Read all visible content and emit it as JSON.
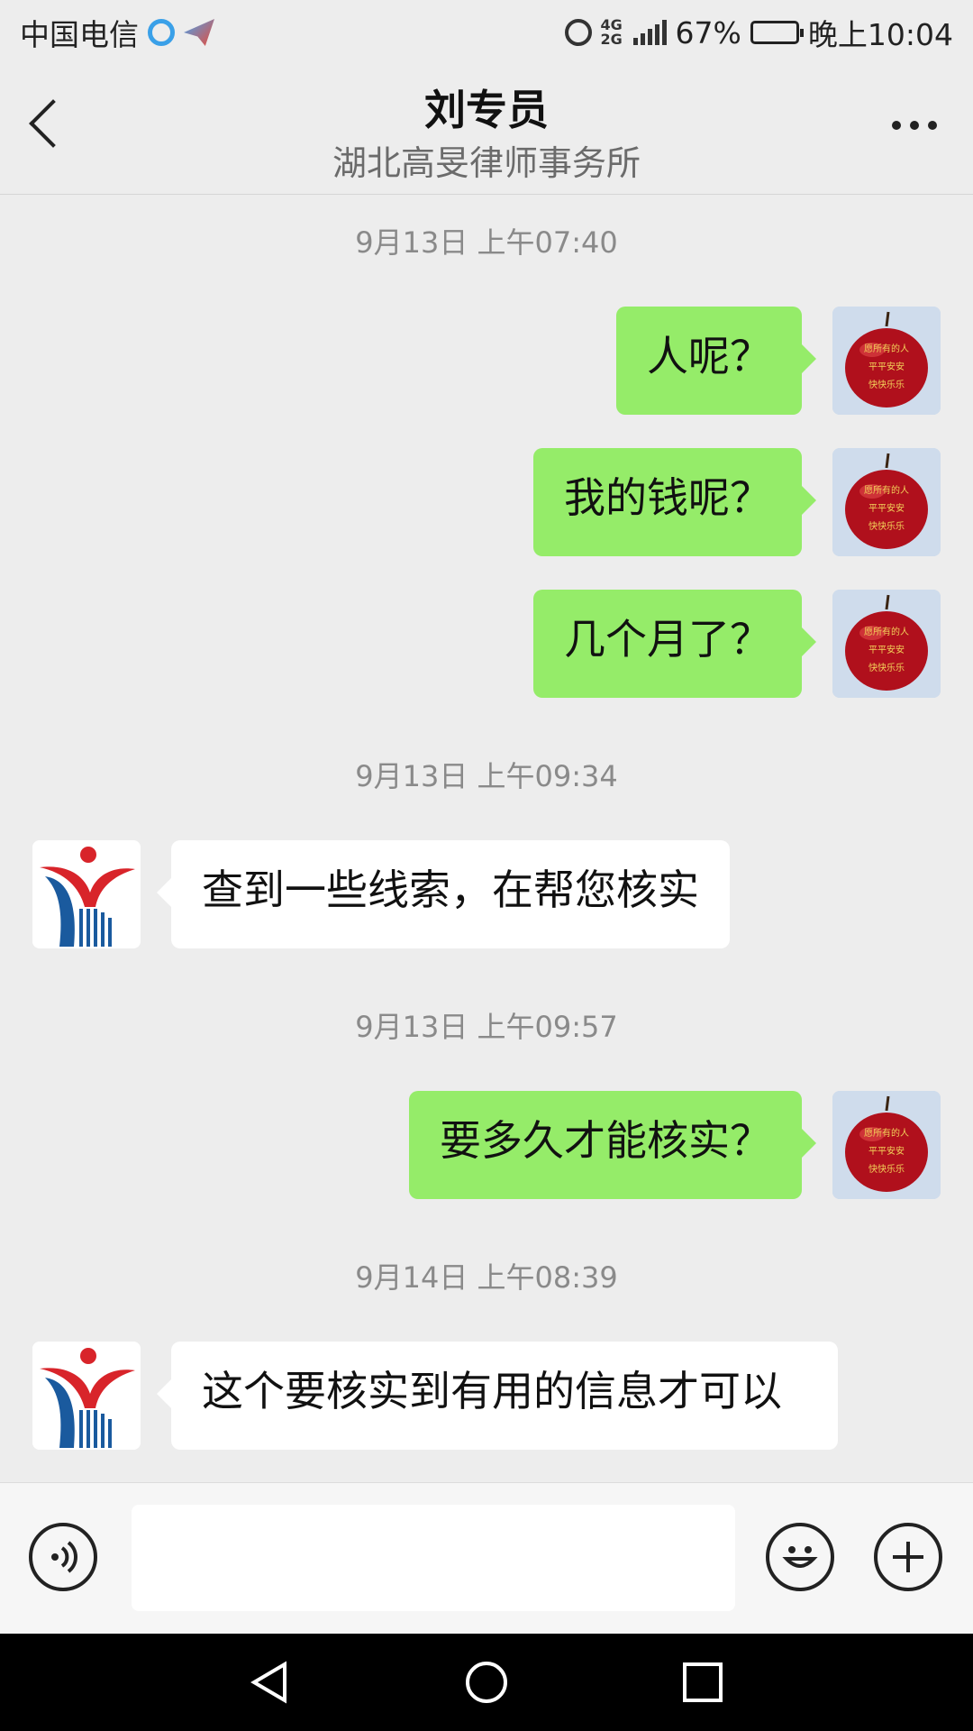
{
  "status_bar": {
    "carrier": "中国电信",
    "network": "4G 2G",
    "battery": "67%",
    "time": "晚上10:04",
    "battery_level": 0.67,
    "icons": [
      "browser-icon",
      "send-app-icon",
      "alarm-icon",
      "signal-icon",
      "battery-icon"
    ]
  },
  "header": {
    "title": "刘专员",
    "subtitle": "湖北高旻律师事务所",
    "icons": [
      "back-icon",
      "more-icon"
    ]
  },
  "messages": [
    {
      "type": "time",
      "text": "9月13日 上午07:40"
    },
    {
      "type": "msg",
      "sender": "me",
      "text": "人呢？"
    },
    {
      "type": "msg",
      "sender": "me",
      "text": "我的钱呢？"
    },
    {
      "type": "msg",
      "sender": "me",
      "text": "几个月了？"
    },
    {
      "type": "time",
      "text": "9月13日 上午09:34"
    },
    {
      "type": "msg",
      "sender": "them",
      "text": "查到一些线索，在帮您核实"
    },
    {
      "type": "time",
      "text": "9月13日 上午09:57"
    },
    {
      "type": "msg",
      "sender": "me",
      "text": "要多久才能核实？"
    },
    {
      "type": "time",
      "text": "9月14日 上午08:39"
    },
    {
      "type": "msg",
      "sender": "them",
      "text": "这个要核实到有用的信息才可以"
    }
  ],
  "avatar_me": {
    "lettering": [
      "愿所有的人",
      "平平安安",
      "快快乐乐"
    ]
  },
  "colors": {
    "my_bubble": "#95ec69",
    "their_bubble": "#ffffff",
    "background": "#ededed"
  },
  "input_bar": {
    "icons": [
      "voice-icon",
      "emoji-icon",
      "plus-icon"
    ]
  },
  "nav_bar": {
    "icons": [
      "nav-back-icon",
      "nav-home-icon",
      "nav-recent-icon"
    ]
  }
}
